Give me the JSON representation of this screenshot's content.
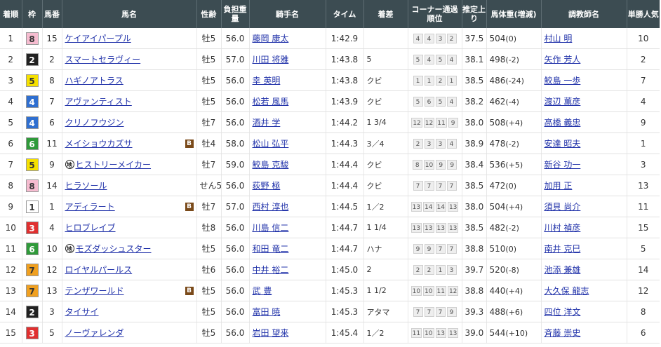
{
  "headers": {
    "rank": "着順",
    "waku": "枠",
    "umaban": "馬番",
    "horse": "馬名",
    "sexage": "性齢",
    "weight": "負担重量",
    "jockey": "騎手名",
    "time": "タイム",
    "margin": "着差",
    "corner": "コーナー通過順位",
    "last3f": "推定上り",
    "bodyweight": "馬体重(増減)",
    "trainer": "調教師名",
    "pop": "単勝人気"
  },
  "colors": {
    "header_bg": "#3c4c52",
    "link": "#2233aa",
    "waku1": "#ffffff",
    "waku2": "#222222",
    "waku3": "#e03030",
    "waku4": "#2f6fd0",
    "waku5": "#f5e000",
    "waku6": "#2f9a3a",
    "waku7": "#f0a020",
    "waku8": "#f6bcd0",
    "blinker_badge": "#7a4a1a"
  },
  "badge_text": {
    "blinker": "B",
    "local": "地"
  },
  "rows": [
    {
      "rank": "1",
      "waku": "8",
      "umaban": "15",
      "horse": "ケイアイパープル",
      "local": false,
      "blinker": false,
      "sexage": "牡5",
      "weight": "56.0",
      "jockey": "藤岡 康太",
      "time": "1:42.9",
      "margin": "",
      "corner": [
        "4",
        "4",
        "3",
        "2"
      ],
      "last3f": "37.5",
      "bw": "504",
      "bwd": "(0)",
      "trainer": "村山 明",
      "pop": "10"
    },
    {
      "rank": "2",
      "waku": "2",
      "umaban": "2",
      "horse": "スマートセラヴィー",
      "local": false,
      "blinker": false,
      "sexage": "牡5",
      "weight": "57.0",
      "jockey": "川田 将雅",
      "time": "1:43.8",
      "margin": "5",
      "corner": [
        "5",
        "4",
        "5",
        "4"
      ],
      "last3f": "38.1",
      "bw": "498",
      "bwd": "(-2)",
      "trainer": "矢作 芳人",
      "pop": "2"
    },
    {
      "rank": "3",
      "waku": "5",
      "umaban": "8",
      "horse": "ハギノアトラス",
      "local": false,
      "blinker": false,
      "sexage": "牡5",
      "weight": "56.0",
      "jockey": "幸 英明",
      "time": "1:43.8",
      "margin": "クビ",
      "corner": [
        "1",
        "1",
        "2",
        "1"
      ],
      "last3f": "38.5",
      "bw": "486",
      "bwd": "(-24)",
      "trainer": "鮫島 一歩",
      "pop": "7"
    },
    {
      "rank": "4",
      "waku": "4",
      "umaban": "7",
      "horse": "アヴァンティスト",
      "local": false,
      "blinker": false,
      "sexage": "牡5",
      "weight": "56.0",
      "jockey": "松若 風馬",
      "time": "1:43.9",
      "margin": "クビ",
      "corner": [
        "5",
        "6",
        "5",
        "4"
      ],
      "last3f": "38.2",
      "bw": "462",
      "bwd": "(-4)",
      "trainer": "渡辺 薫彦",
      "pop": "4"
    },
    {
      "rank": "5",
      "waku": "4",
      "umaban": "6",
      "horse": "クリノフウジン",
      "local": false,
      "blinker": false,
      "sexage": "牡7",
      "weight": "56.0",
      "jockey": "酒井 学",
      "time": "1:44.2",
      "margin": "1 3/4",
      "corner": [
        "12",
        "12",
        "11",
        "9"
      ],
      "last3f": "38.0",
      "bw": "508",
      "bwd": "(+4)",
      "trainer": "高橋 義忠",
      "pop": "9"
    },
    {
      "rank": "6",
      "waku": "6",
      "umaban": "11",
      "horse": "メイショウカズサ",
      "local": false,
      "blinker": true,
      "sexage": "牡4",
      "weight": "58.0",
      "jockey": "松山 弘平",
      "time": "1:44.3",
      "margin": "3／4",
      "corner": [
        "2",
        "3",
        "3",
        "4"
      ],
      "last3f": "38.9",
      "bw": "478",
      "bwd": "(-2)",
      "trainer": "安達 昭夫",
      "pop": "1"
    },
    {
      "rank": "7",
      "waku": "5",
      "umaban": "9",
      "horse": "ヒストリーメイカー",
      "local": true,
      "blinker": false,
      "sexage": "牡7",
      "weight": "59.0",
      "jockey": "鮫島 克駿",
      "time": "1:44.4",
      "margin": "クビ",
      "corner": [
        "8",
        "10",
        "9",
        "9"
      ],
      "last3f": "38.4",
      "bw": "536",
      "bwd": "(+5)",
      "trainer": "新谷 功一",
      "pop": "3"
    },
    {
      "rank": "8",
      "waku": "8",
      "umaban": "14",
      "horse": "ヒラソール",
      "local": false,
      "blinker": false,
      "sexage": "せん5",
      "weight": "56.0",
      "jockey": "荻野 極",
      "time": "1:44.4",
      "margin": "クビ",
      "corner": [
        "7",
        "7",
        "7",
        "7"
      ],
      "last3f": "38.5",
      "bw": "472",
      "bwd": "(0)",
      "trainer": "加用 正",
      "pop": "13"
    },
    {
      "rank": "9",
      "waku": "1",
      "umaban": "1",
      "horse": "アディラート",
      "local": false,
      "blinker": true,
      "sexage": "牡7",
      "weight": "57.0",
      "jockey": "西村 淳也",
      "time": "1:44.5",
      "margin": "1／2",
      "corner": [
        "13",
        "14",
        "14",
        "13"
      ],
      "last3f": "38.0",
      "bw": "504",
      "bwd": "(+4)",
      "trainer": "須貝 尚介",
      "pop": "11"
    },
    {
      "rank": "10",
      "waku": "3",
      "umaban": "4",
      "horse": "ヒロブレイブ",
      "local": false,
      "blinker": false,
      "sexage": "牡8",
      "weight": "56.0",
      "jockey": "川島 信二",
      "time": "1:44.7",
      "margin": "1 1/4",
      "corner": [
        "13",
        "13",
        "13",
        "13"
      ],
      "last3f": "38.5",
      "bw": "482",
      "bwd": "(-2)",
      "trainer": "川村 禎彦",
      "pop": "15"
    },
    {
      "rank": "11",
      "waku": "6",
      "umaban": "10",
      "horse": "モズダッシュスター",
      "local": true,
      "blinker": false,
      "sexage": "牡5",
      "weight": "56.0",
      "jockey": "和田 竜二",
      "time": "1:44.7",
      "margin": "ハナ",
      "corner": [
        "9",
        "9",
        "7",
        "7"
      ],
      "last3f": "38.8",
      "bw": "510",
      "bwd": "(0)",
      "trainer": "南井 克巳",
      "pop": "5"
    },
    {
      "rank": "12",
      "waku": "7",
      "umaban": "12",
      "horse": "ロイヤルパールス",
      "local": false,
      "blinker": false,
      "sexage": "牡6",
      "weight": "56.0",
      "jockey": "中井 裕二",
      "time": "1:45.0",
      "margin": "2",
      "corner": [
        "2",
        "2",
        "1",
        "3"
      ],
      "last3f": "39.7",
      "bw": "520",
      "bwd": "(-8)",
      "trainer": "池添 兼雄",
      "pop": "14"
    },
    {
      "rank": "13",
      "waku": "7",
      "umaban": "13",
      "horse": "テンザワールド",
      "local": false,
      "blinker": true,
      "sexage": "牡5",
      "weight": "56.0",
      "jockey": "武 豊",
      "time": "1:45.3",
      "margin": "1 1/2",
      "corner": [
        "10",
        "10",
        "11",
        "12"
      ],
      "last3f": "38.8",
      "bw": "440",
      "bwd": "(+4)",
      "trainer": "大久保 龍志",
      "pop": "12"
    },
    {
      "rank": "14",
      "waku": "2",
      "umaban": "3",
      "horse": "タイサイ",
      "local": false,
      "blinker": false,
      "sexage": "牡5",
      "weight": "56.0",
      "jockey": "富田 暁",
      "time": "1:45.3",
      "margin": "アタマ",
      "corner": [
        "7",
        "7",
        "7",
        "9"
      ],
      "last3f": "39.3",
      "bw": "488",
      "bwd": "(+6)",
      "trainer": "四位 洋文",
      "pop": "8"
    },
    {
      "rank": "15",
      "waku": "3",
      "umaban": "5",
      "horse": "ノーヴァレンダ",
      "local": false,
      "blinker": false,
      "sexage": "牡5",
      "weight": "56.0",
      "jockey": "岩田 望来",
      "time": "1:45.4",
      "margin": "1／2",
      "corner": [
        "11",
        "10",
        "13",
        "13"
      ],
      "last3f": "39.0",
      "bw": "544",
      "bwd": "(+10)",
      "trainer": "斉藤 崇史",
      "pop": "6"
    }
  ]
}
